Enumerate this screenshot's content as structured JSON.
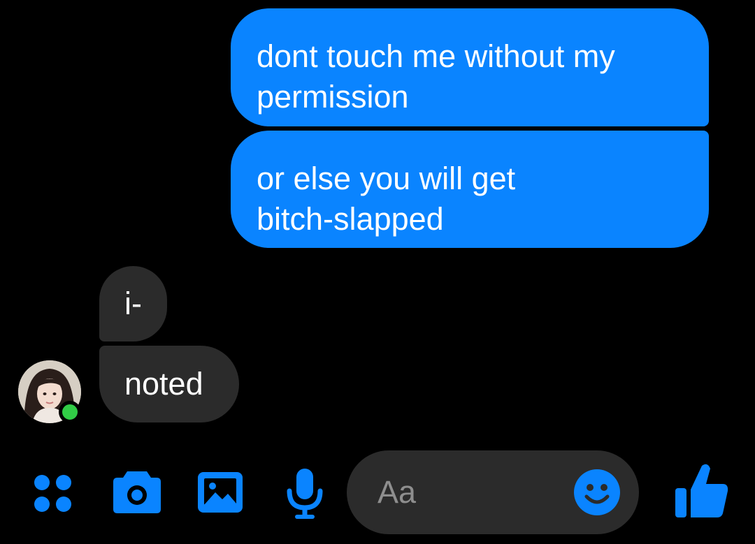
{
  "messages": [
    {
      "direction": "outgoing",
      "text": "dont touch me without my permission",
      "lines": [
        "dont touch me without my",
        "permission"
      ]
    },
    {
      "direction": "outgoing",
      "text": "or else you will get bitch-slapped",
      "lines": [
        "or else you will get",
        "bitch-slapped"
      ]
    },
    {
      "direction": "incoming",
      "text": "i-"
    },
    {
      "direction": "incoming",
      "text": "noted"
    }
  ],
  "contact": {
    "online": true
  },
  "composer": {
    "placeholder": "Aa",
    "icons": [
      "apps-grid-icon",
      "camera-icon",
      "gallery-icon",
      "microphone-icon",
      "emoji-icon",
      "thumbs-up-icon"
    ]
  },
  "colors": {
    "background": "#000000",
    "outgoing_bubble": "#0a84ff",
    "incoming_bubble": "#2b2b2b",
    "accent": "#0a84ff",
    "online": "#31cc46",
    "text": "#ffffff",
    "placeholder": "#8e8e8e"
  }
}
